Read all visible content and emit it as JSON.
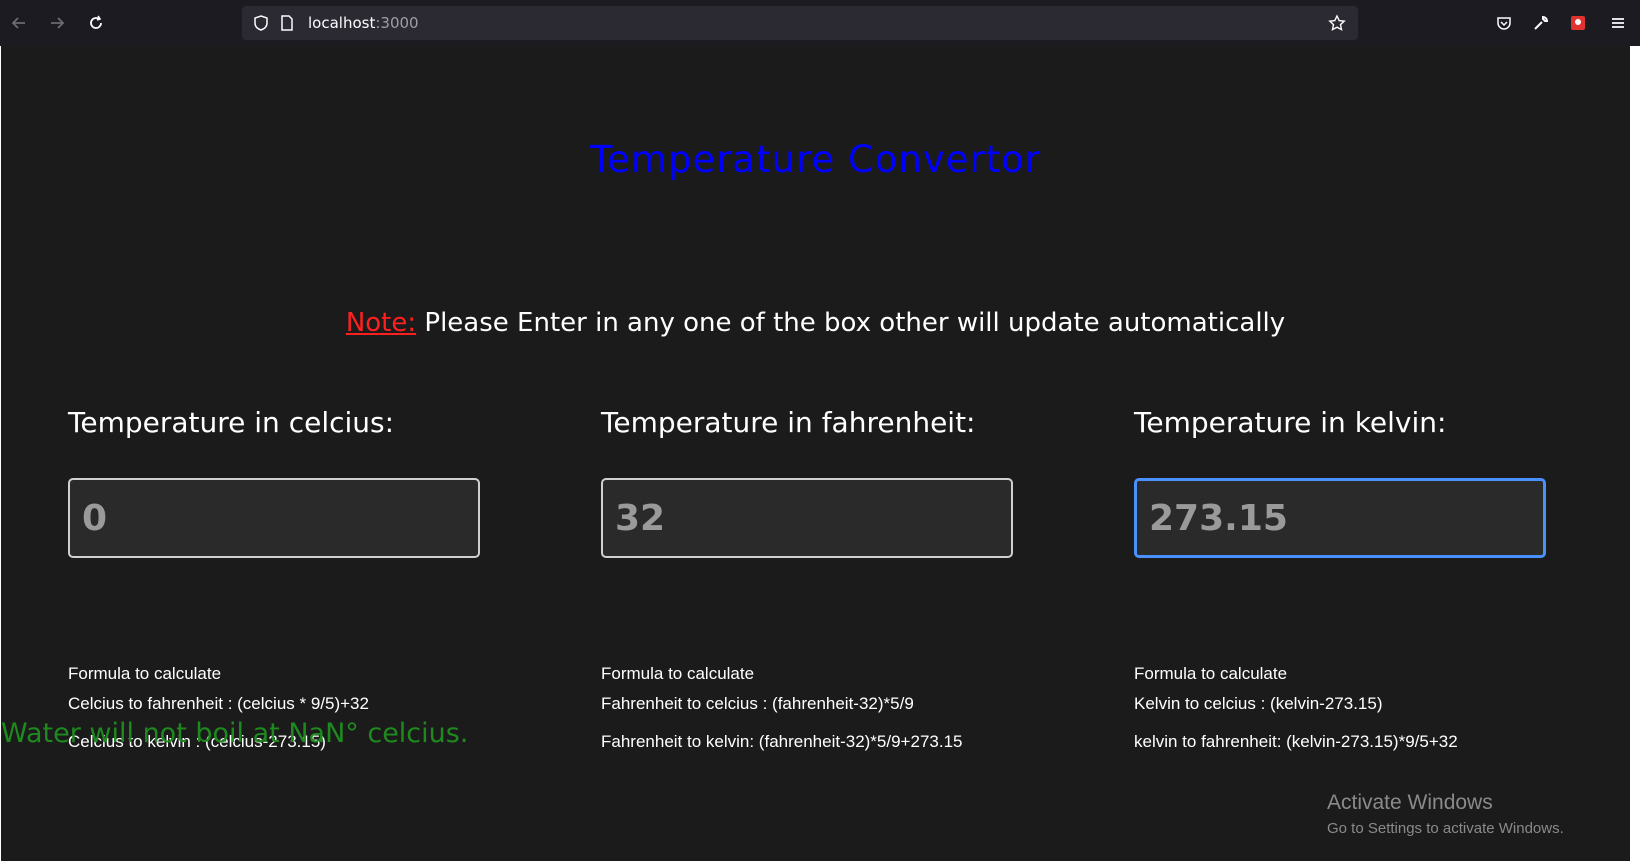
{
  "browser": {
    "url_host": "localhost",
    "url_port": ":3000",
    "icons": [
      "back-icon",
      "forward-icon",
      "reload-icon",
      "shield-icon",
      "page-icon",
      "star-icon",
      "pocket-icon",
      "wrench-icon",
      "extension-icon",
      "menu-icon"
    ]
  },
  "page": {
    "title": "Temperature Convertor",
    "note_label": "Note:",
    "note_text": " Please Enter in any one of the box other will update automatically",
    "columns": [
      {
        "label": "Temperature in celcius:",
        "value": "0",
        "formula_heading": "Formula to calculate",
        "formula_1": "Celcius to fahrenheit : (celcius * 9/5)+32",
        "formula_2": "Celcius to kelvin : (celcius-273.15)"
      },
      {
        "label": "Temperature in fahrenheit:",
        "value": "32",
        "formula_heading": "Formula to calculate",
        "formula_1": "Fahrenheit to celcius : (fahrenheit-32)*5/9",
        "formula_2": "Fahrenheit to kelvin: (fahrenheit-32)*5/9+273.15"
      },
      {
        "label": "Temperature in kelvin:",
        "value": "273.15",
        "formula_heading": "Formula to calculate",
        "formula_1": "Kelvin to celcius : (kelvin-273.15)",
        "formula_2": "kelvin to fahrenheit: (kelvin-273.15)*9/5+32"
      }
    ],
    "status_message": "Water will not boil at NaN° celcius."
  },
  "watermark": {
    "line1": "Activate Windows",
    "line2": "Go to Settings to activate Windows."
  },
  "colors": {
    "title": "#0000ff",
    "note_label": "#ff1f1f",
    "status": "#1e8a1e",
    "focus_border": "#4a90ff"
  }
}
